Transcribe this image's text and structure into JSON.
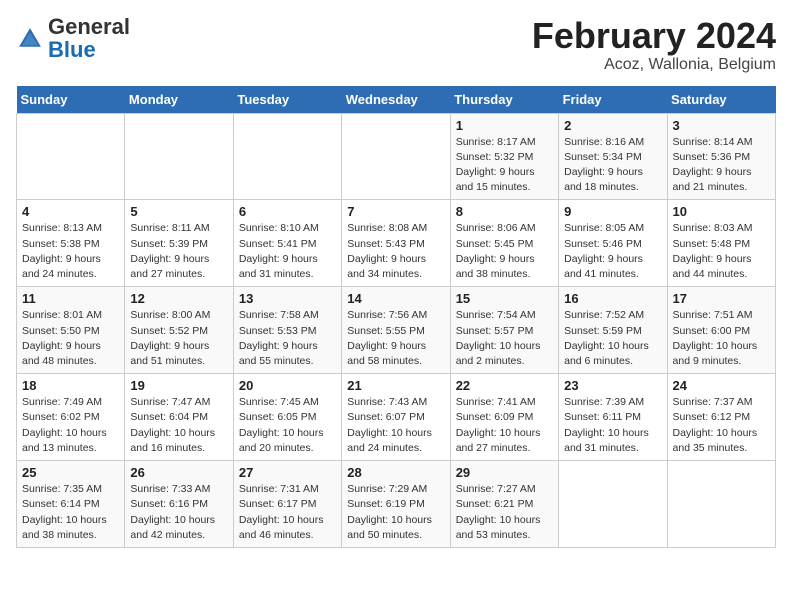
{
  "logo": {
    "general": "General",
    "blue": "Blue"
  },
  "header": {
    "title": "February 2024",
    "subtitle": "Acoz, Wallonia, Belgium"
  },
  "weekdays": [
    "Sunday",
    "Monday",
    "Tuesday",
    "Wednesday",
    "Thursday",
    "Friday",
    "Saturday"
  ],
  "weeks": [
    [
      {
        "day": "",
        "info": ""
      },
      {
        "day": "",
        "info": ""
      },
      {
        "day": "",
        "info": ""
      },
      {
        "day": "",
        "info": ""
      },
      {
        "day": "1",
        "info": "Sunrise: 8:17 AM\nSunset: 5:32 PM\nDaylight: 9 hours\nand 15 minutes."
      },
      {
        "day": "2",
        "info": "Sunrise: 8:16 AM\nSunset: 5:34 PM\nDaylight: 9 hours\nand 18 minutes."
      },
      {
        "day": "3",
        "info": "Sunrise: 8:14 AM\nSunset: 5:36 PM\nDaylight: 9 hours\nand 21 minutes."
      }
    ],
    [
      {
        "day": "4",
        "info": "Sunrise: 8:13 AM\nSunset: 5:38 PM\nDaylight: 9 hours\nand 24 minutes."
      },
      {
        "day": "5",
        "info": "Sunrise: 8:11 AM\nSunset: 5:39 PM\nDaylight: 9 hours\nand 27 minutes."
      },
      {
        "day": "6",
        "info": "Sunrise: 8:10 AM\nSunset: 5:41 PM\nDaylight: 9 hours\nand 31 minutes."
      },
      {
        "day": "7",
        "info": "Sunrise: 8:08 AM\nSunset: 5:43 PM\nDaylight: 9 hours\nand 34 minutes."
      },
      {
        "day": "8",
        "info": "Sunrise: 8:06 AM\nSunset: 5:45 PM\nDaylight: 9 hours\nand 38 minutes."
      },
      {
        "day": "9",
        "info": "Sunrise: 8:05 AM\nSunset: 5:46 PM\nDaylight: 9 hours\nand 41 minutes."
      },
      {
        "day": "10",
        "info": "Sunrise: 8:03 AM\nSunset: 5:48 PM\nDaylight: 9 hours\nand 44 minutes."
      }
    ],
    [
      {
        "day": "11",
        "info": "Sunrise: 8:01 AM\nSunset: 5:50 PM\nDaylight: 9 hours\nand 48 minutes."
      },
      {
        "day": "12",
        "info": "Sunrise: 8:00 AM\nSunset: 5:52 PM\nDaylight: 9 hours\nand 51 minutes."
      },
      {
        "day": "13",
        "info": "Sunrise: 7:58 AM\nSunset: 5:53 PM\nDaylight: 9 hours\nand 55 minutes."
      },
      {
        "day": "14",
        "info": "Sunrise: 7:56 AM\nSunset: 5:55 PM\nDaylight: 9 hours\nand 58 minutes."
      },
      {
        "day": "15",
        "info": "Sunrise: 7:54 AM\nSunset: 5:57 PM\nDaylight: 10 hours\nand 2 minutes."
      },
      {
        "day": "16",
        "info": "Sunrise: 7:52 AM\nSunset: 5:59 PM\nDaylight: 10 hours\nand 6 minutes."
      },
      {
        "day": "17",
        "info": "Sunrise: 7:51 AM\nSunset: 6:00 PM\nDaylight: 10 hours\nand 9 minutes."
      }
    ],
    [
      {
        "day": "18",
        "info": "Sunrise: 7:49 AM\nSunset: 6:02 PM\nDaylight: 10 hours\nand 13 minutes."
      },
      {
        "day": "19",
        "info": "Sunrise: 7:47 AM\nSunset: 6:04 PM\nDaylight: 10 hours\nand 16 minutes."
      },
      {
        "day": "20",
        "info": "Sunrise: 7:45 AM\nSunset: 6:05 PM\nDaylight: 10 hours\nand 20 minutes."
      },
      {
        "day": "21",
        "info": "Sunrise: 7:43 AM\nSunset: 6:07 PM\nDaylight: 10 hours\nand 24 minutes."
      },
      {
        "day": "22",
        "info": "Sunrise: 7:41 AM\nSunset: 6:09 PM\nDaylight: 10 hours\nand 27 minutes."
      },
      {
        "day": "23",
        "info": "Sunrise: 7:39 AM\nSunset: 6:11 PM\nDaylight: 10 hours\nand 31 minutes."
      },
      {
        "day": "24",
        "info": "Sunrise: 7:37 AM\nSunset: 6:12 PM\nDaylight: 10 hours\nand 35 minutes."
      }
    ],
    [
      {
        "day": "25",
        "info": "Sunrise: 7:35 AM\nSunset: 6:14 PM\nDaylight: 10 hours\nand 38 minutes."
      },
      {
        "day": "26",
        "info": "Sunrise: 7:33 AM\nSunset: 6:16 PM\nDaylight: 10 hours\nand 42 minutes."
      },
      {
        "day": "27",
        "info": "Sunrise: 7:31 AM\nSunset: 6:17 PM\nDaylight: 10 hours\nand 46 minutes."
      },
      {
        "day": "28",
        "info": "Sunrise: 7:29 AM\nSunset: 6:19 PM\nDaylight: 10 hours\nand 50 minutes."
      },
      {
        "day": "29",
        "info": "Sunrise: 7:27 AM\nSunset: 6:21 PM\nDaylight: 10 hours\nand 53 minutes."
      },
      {
        "day": "",
        "info": ""
      },
      {
        "day": "",
        "info": ""
      }
    ]
  ]
}
